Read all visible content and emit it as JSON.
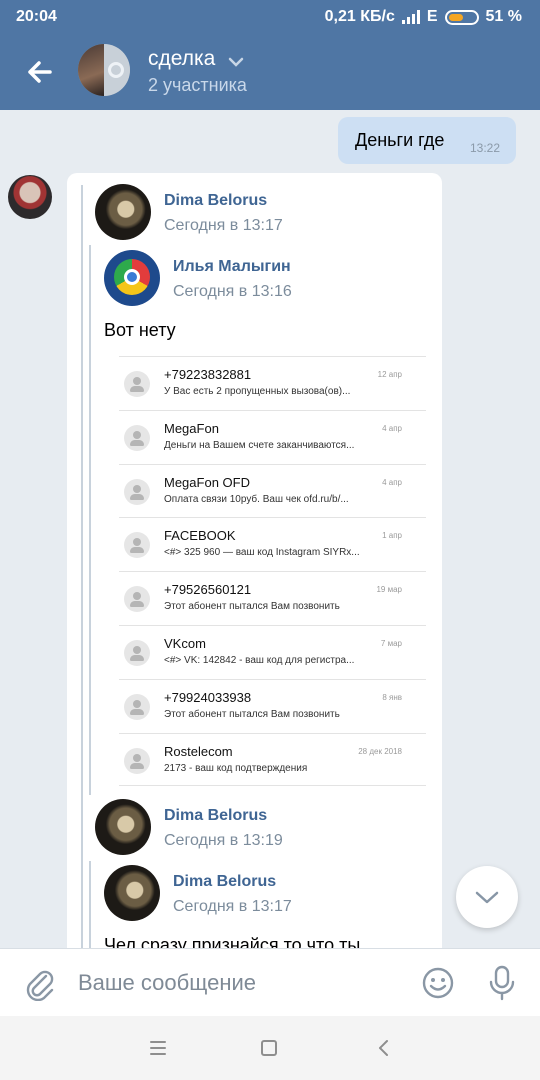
{
  "status_bar": {
    "time": "20:04",
    "network": "0,21 КБ/с",
    "net_type": "E",
    "battery": "51 %",
    "battery_level": 0.51
  },
  "header": {
    "title": "сделка",
    "subtitle": "2 участника"
  },
  "outgoing_message": {
    "text": "Деньги где",
    "time": "13:22"
  },
  "forwarded": {
    "first": {
      "name": "Dima Belorus",
      "date": "Сегодня в 13:17"
    },
    "nested": {
      "name": "Илья Малыгин",
      "date": "Сегодня в 13:16",
      "text": "Вот нету"
    },
    "sms_list": [
      {
        "name": "+79223832881",
        "preview": "У Вас есть 2 пропущенных вызова(ов)...",
        "date": "12 апр"
      },
      {
        "name": "MegaFon",
        "preview": "Деньги на Вашем счете заканчиваются...",
        "date": "4 апр"
      },
      {
        "name": "MegaFon OFD",
        "preview": "Оплата связи 10руб. Ваш чек ofd.ru/b/...",
        "date": "4 апр"
      },
      {
        "name": "FACEBOOK",
        "preview": "<#> 325 960 — ваш код Instagram SIYRx...",
        "date": "1 апр"
      },
      {
        "name": "+79526560121",
        "preview": "Этот абонент пытался Вам позвонить",
        "date": "19 мар"
      },
      {
        "name": "VKcom",
        "preview": "<#> VK: 142842 - ваш код для регистра...",
        "date": "7 мар"
      },
      {
        "name": "+79924033938",
        "preview": "Этот абонент пытался Вам позвонить",
        "date": "8 янв"
      },
      {
        "name": "Rostelecom",
        "preview": "2173 - ваш код подтверждения",
        "date": "28 дек 2018"
      }
    ],
    "second": {
      "name": "Dima Belorus",
      "date": "Сегодня в 13:19"
    },
    "second_nested": {
      "name": "Dima Belorus",
      "date": "Сегодня в 13:17"
    },
    "cut_text": "Чел сразу признайся то что ты"
  },
  "composer": {
    "placeholder": "Ваше сообщение"
  },
  "icons": {
    "back": "arrow-left-icon",
    "attach": "paperclip-icon",
    "emoji": "smile-icon",
    "mic": "microphone-icon",
    "scroll": "chevron-down-icon"
  }
}
